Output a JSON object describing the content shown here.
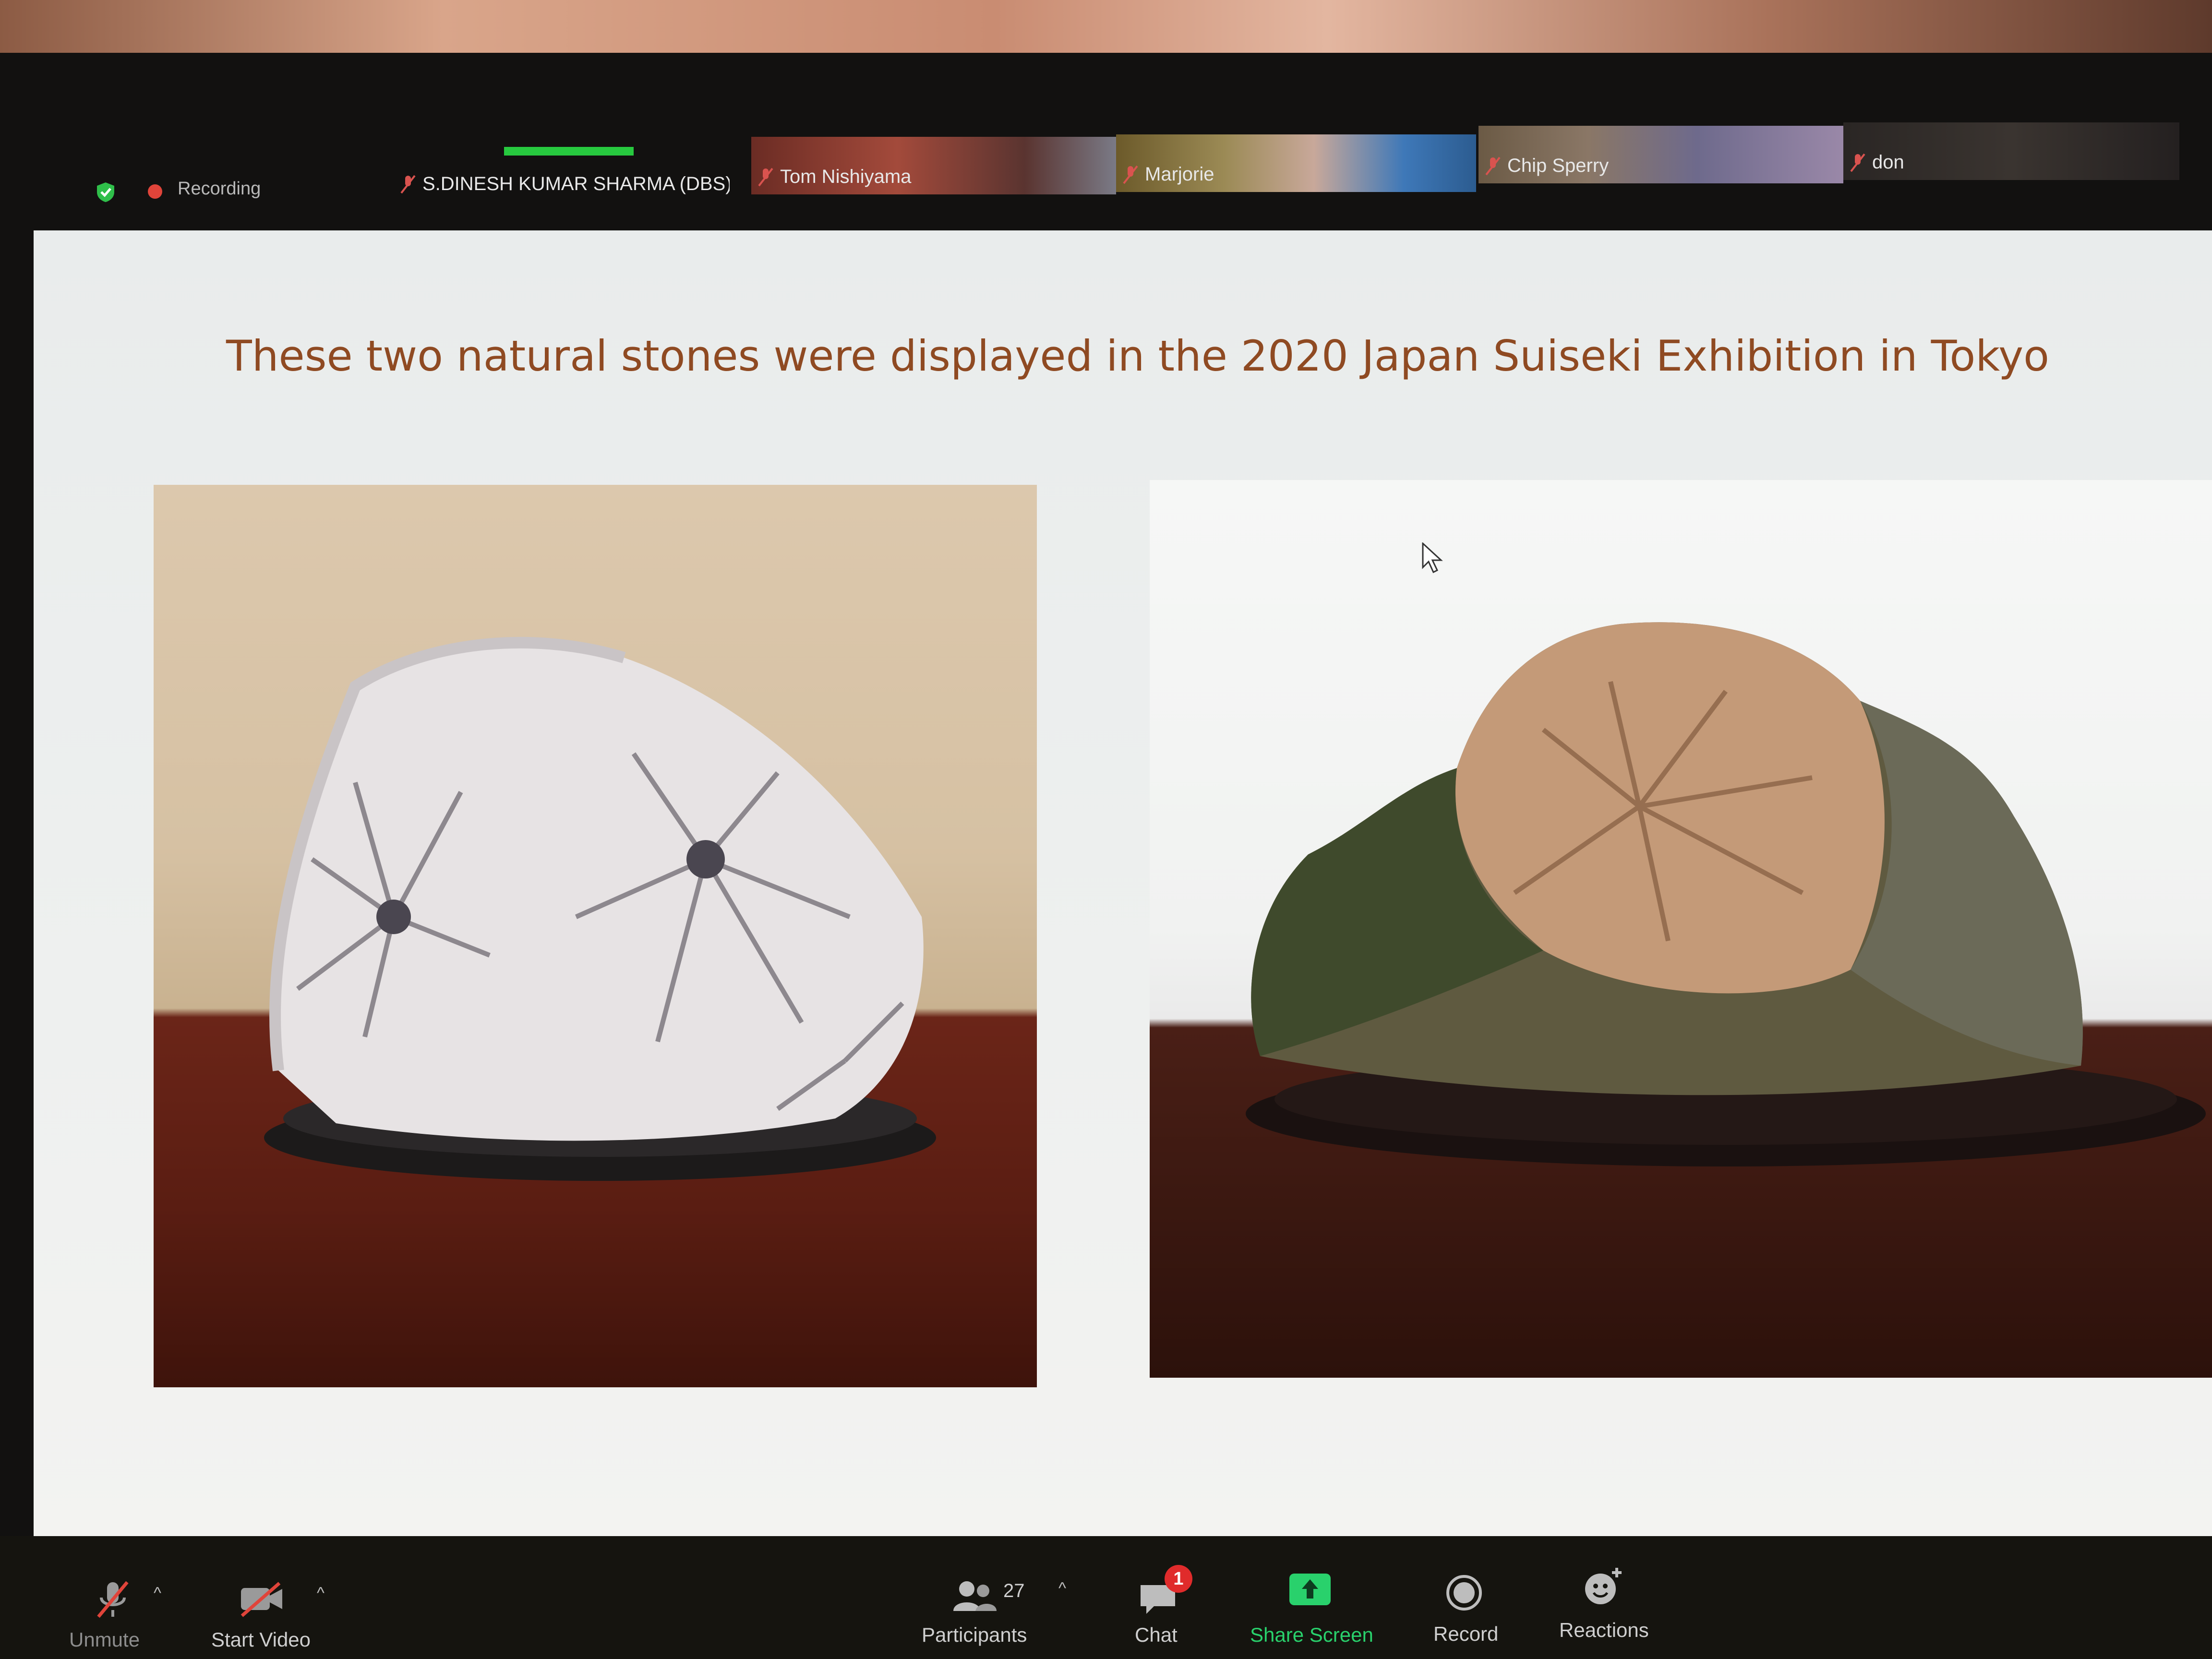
{
  "meeting": {
    "recording_label": "Recording",
    "participants": [
      {
        "name": "S.DINESH KUMAR SHARMA (DBS)"
      },
      {
        "name": "Tom Nishiyama"
      },
      {
        "name": "Marjorie"
      },
      {
        "name": "Chip Sperry"
      },
      {
        "name": "don"
      }
    ]
  },
  "slide": {
    "title": "These two natural stones were displayed in the 2020 Japan Suiseki Exhibition in Tokyo"
  },
  "toolbar": {
    "unmute_label": "Unmute",
    "start_video_label": "Start Video",
    "participants_label": "Participants",
    "participants_count": "27",
    "chat_label": "Chat",
    "chat_badge": "1",
    "share_screen_label": "Share Screen",
    "record_label": "Record",
    "reactions_label": "Reactions"
  },
  "colors": {
    "accent_green": "#27c93f",
    "share_green": "#29d16c",
    "badge_red": "#e02b2b",
    "title_brown": "#8f4a22"
  }
}
